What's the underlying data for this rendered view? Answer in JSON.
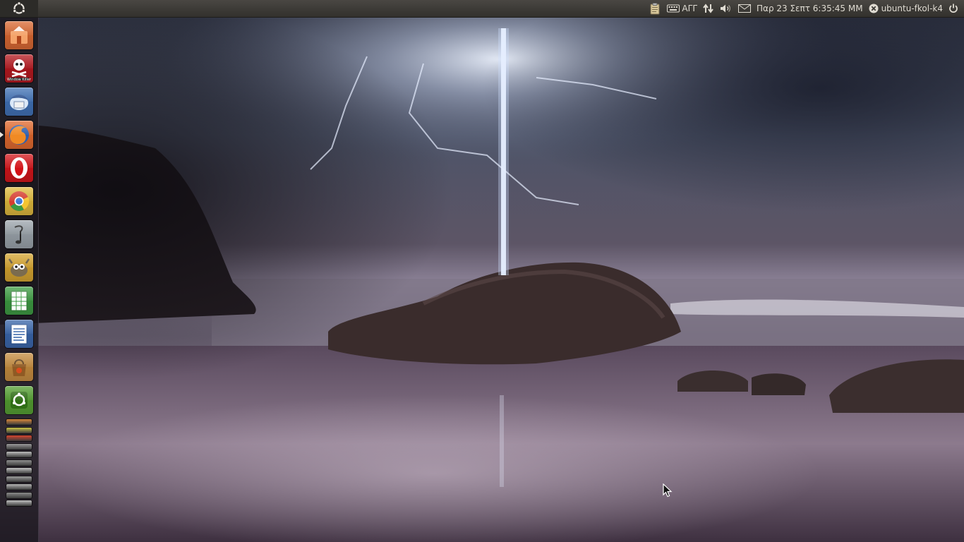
{
  "top_panel": {
    "indicators": {
      "keyboard_layout": "ΑΓΓ",
      "datetime": "Παρ 23 Σεπτ  6:35:45 ΜΜ",
      "session_user": "ubuntu-fkol-k4"
    }
  },
  "launcher": {
    "items": [
      {
        "icon": "home-folder-icon",
        "color": "#d9662e"
      },
      {
        "icon": "window-killer-icon",
        "label": "Window Killer",
        "color": "#b3151b"
      },
      {
        "icon": "thunderbird-icon",
        "color": "#3d6fb4"
      },
      {
        "icon": "firefox-icon",
        "color": "#e2682b",
        "running": true
      },
      {
        "icon": "opera-icon",
        "color": "#d31217"
      },
      {
        "icon": "chrome-icon",
        "color": "#e0b93a"
      },
      {
        "icon": "inkscape-icon",
        "color": "#9aa3aa"
      },
      {
        "icon": "gimp-icon",
        "color": "#d6a42d"
      },
      {
        "icon": "calc-spreadsheet-icon",
        "color": "#3a9a3f"
      },
      {
        "icon": "writer-document-icon",
        "color": "#3563a8"
      },
      {
        "icon": "software-center-icon",
        "color": "#c48a3a"
      },
      {
        "icon": "system-settings-icon",
        "color": "#4f9c2b"
      }
    ],
    "stacked": [
      {
        "icon": "stacked-app-icon",
        "color": "#d8863a"
      },
      {
        "icon": "stacked-app-icon",
        "color": "#c9c247"
      },
      {
        "icon": "stacked-app-icon",
        "color": "#d4452f"
      },
      {
        "icon": "stacked-app-icon",
        "color": "#9a9a9a"
      },
      {
        "icon": "stacked-app-icon",
        "color": "#bdbdbd"
      },
      {
        "icon": "stacked-app-icon",
        "color": "#8f8f8f"
      },
      {
        "icon": "stacked-app-icon",
        "color": "#c4c4c4"
      },
      {
        "icon": "stacked-app-icon",
        "color": "#9c9c9c"
      },
      {
        "icon": "stacked-app-icon",
        "color": "#b5b5b5"
      },
      {
        "icon": "stacked-app-icon",
        "color": "#8a8a8a"
      },
      {
        "icon": "stacked-app-icon",
        "color": "#c0c0c0"
      }
    ]
  },
  "colors": {
    "panel": "#3b3935",
    "accent": "#dd4814"
  }
}
